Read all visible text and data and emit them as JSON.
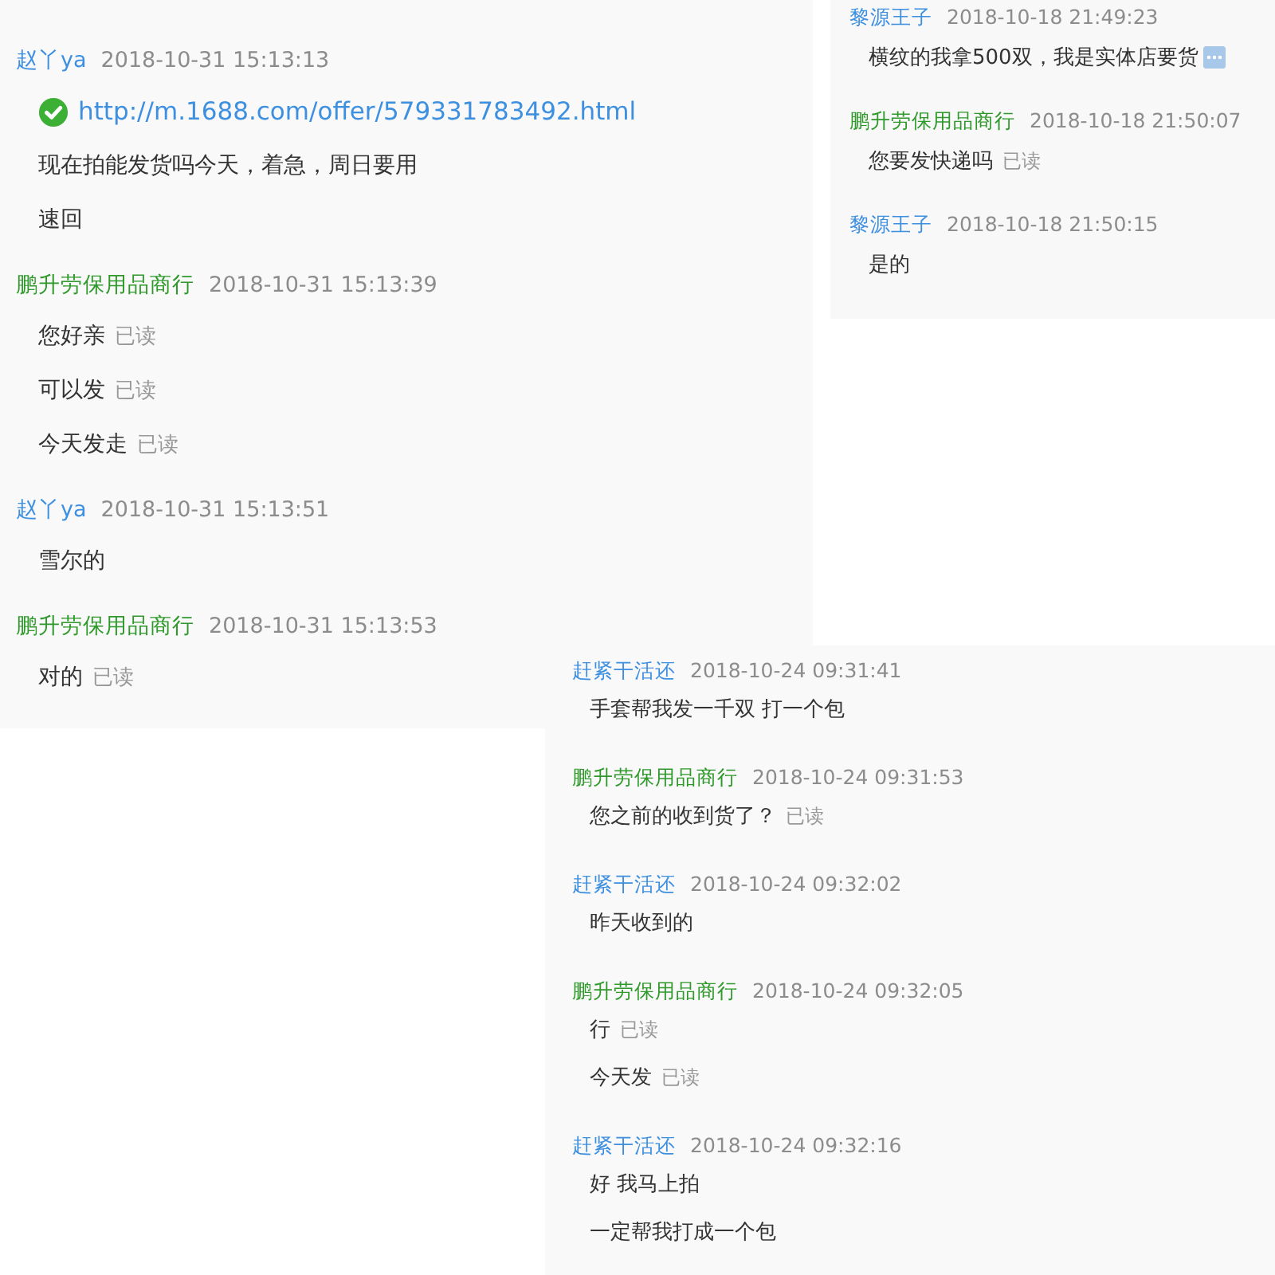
{
  "panels": [
    {
      "messages": [
        {
          "sender": "赵丫ya",
          "kind": "customer",
          "time": "2018-10-31 15:13:13",
          "lines": [
            {
              "kind": "link",
              "text": "http://m.1688.com/offer/579331783492.html"
            },
            {
              "kind": "text",
              "text": "现在拍能发货吗今天，着急，周日要用"
            },
            {
              "kind": "text",
              "text": "速回"
            }
          ]
        },
        {
          "sender": "鹏升劳保用品商行",
          "kind": "seller",
          "time": "2018-10-31 15:13:39",
          "lines": [
            {
              "kind": "text",
              "text": "您好亲",
              "status": "已读"
            },
            {
              "kind": "text",
              "text": "可以发",
              "status": "已读"
            },
            {
              "kind": "text",
              "text": "今天发走",
              "status": "已读"
            }
          ]
        },
        {
          "sender": "赵丫ya",
          "kind": "customer",
          "time": "2018-10-31 15:13:51",
          "lines": [
            {
              "kind": "text",
              "text": "雪尔的"
            }
          ]
        },
        {
          "sender": "鹏升劳保用品商行",
          "kind": "seller",
          "time": "2018-10-31 15:13:53",
          "lines": [
            {
              "kind": "text",
              "text": "对的",
              "status": "已读"
            }
          ]
        }
      ]
    },
    {
      "messages": [
        {
          "sender": "黎源王子",
          "kind": "customer",
          "time": "2018-10-18 21:49:23",
          "lines": [
            {
              "kind": "text",
              "text": "横纹的我拿500双，我是实体店要货",
              "more": true
            }
          ]
        },
        {
          "sender": "鹏升劳保用品商行",
          "kind": "seller",
          "time": "2018-10-18 21:50:07",
          "lines": [
            {
              "kind": "text",
              "text": "您要发快递吗",
              "status": "已读"
            }
          ]
        },
        {
          "sender": "黎源王子",
          "kind": "customer",
          "time": "2018-10-18 21:50:15",
          "lines": [
            {
              "kind": "text",
              "text": "是的"
            }
          ]
        }
      ]
    },
    {
      "messages": [
        {
          "sender": "赶紧干活还",
          "kind": "customer",
          "time": "2018-10-24 09:31:41",
          "lines": [
            {
              "kind": "text",
              "text": "手套帮我发一千双  打一个包"
            }
          ]
        },
        {
          "sender": "鹏升劳保用品商行",
          "kind": "seller",
          "time": "2018-10-24 09:31:53",
          "lines": [
            {
              "kind": "text",
              "text": "您之前的收到货了？",
              "status": "已读"
            }
          ]
        },
        {
          "sender": "赶紧干活还",
          "kind": "customer",
          "time": "2018-10-24 09:32:02",
          "lines": [
            {
              "kind": "text",
              "text": "昨天收到的"
            }
          ]
        },
        {
          "sender": "鹏升劳保用品商行",
          "kind": "seller",
          "time": "2018-10-24 09:32:05",
          "lines": [
            {
              "kind": "text",
              "text": "行",
              "status": "已读"
            },
            {
              "kind": "text",
              "text": "今天发",
              "status": "已读"
            }
          ]
        },
        {
          "sender": "赶紧干活还",
          "kind": "customer",
          "time": "2018-10-24 09:32:16",
          "lines": [
            {
              "kind": "text",
              "text": "好  我马上拍"
            },
            {
              "kind": "text",
              "text": "一定帮我打成一个包"
            }
          ]
        }
      ]
    }
  ]
}
